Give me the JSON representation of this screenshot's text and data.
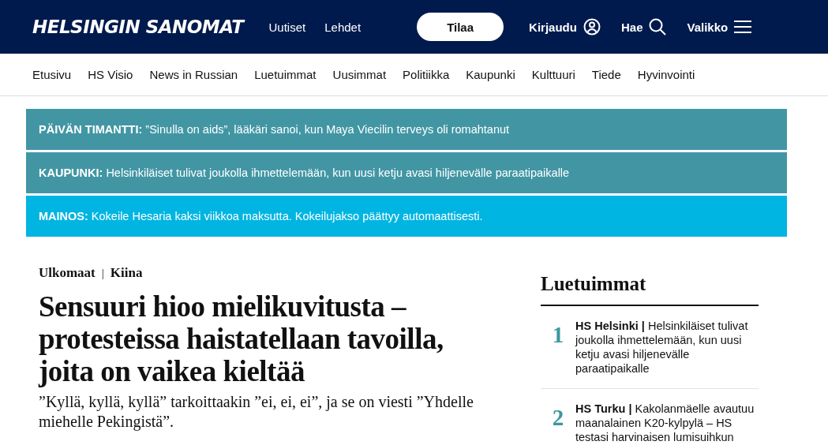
{
  "header": {
    "logo": "HELSINGIN SANOMAT",
    "links": [
      "Uutiset",
      "Lehdet"
    ],
    "subscribe_button": "Tilaa",
    "login": "Kirjaudu",
    "search": "Hae",
    "menu": "Valikko"
  },
  "nav": [
    "Etusivu",
    "HS Visio",
    "News in Russian",
    "Luetuimmat",
    "Uusimmat",
    "Politiikka",
    "Kaupunki",
    "Kulttuuri",
    "Tiede",
    "Hyvinvointi"
  ],
  "banners": [
    {
      "label": "PÄIVÄN TIMANTTI:",
      "text": "”Sinulla on aids”, lääkäri sanoi, kun Maya Viecilin terveys oli romahtanut",
      "color": "#4296a4"
    },
    {
      "label": "KAUPUNKI:",
      "text": "Helsinkiläiset tulivat joukolla ihmettelemään, kun uusi ketju avasi hiljenevälle paraatipaikalle",
      "color": "#4296a4"
    },
    {
      "label": "MAINOS:",
      "text": "Kokeile Hesaria kaksi viikkoa maksutta. Kokeilujakso päättyy automaattisesti.",
      "color": "#00b5e2"
    }
  ],
  "article": {
    "section": "Ulkomaat",
    "separator": "|",
    "subsection": "Kiina",
    "headline": "Sensuuri hioo mielikuvitusta – protesteissa haistatellaan tavoilla, joita on vaikea kieltää",
    "lead": "”Kyllä, kyllä, kyllä” tarkoittaakin ”ei, ei, ei”, ja se on viesti ”Yhdelle miehelle Pekingistä”."
  },
  "most_read": {
    "title": "Luetuimmat",
    "items": [
      {
        "number": "1",
        "text": "**HS Helsinki |** Helsinkiläiset tulivat joukolla ihmettelemään, kun uusi ketju avasi hiljenevälle paraatipaikalle"
      },
      {
        "number": "2",
        "text": "**HS Turku |** Kakolanmäelle avautuu maanalainen K20-kylpylä – HS testasi harvinaisen lumisuihkun"
      }
    ]
  }
}
